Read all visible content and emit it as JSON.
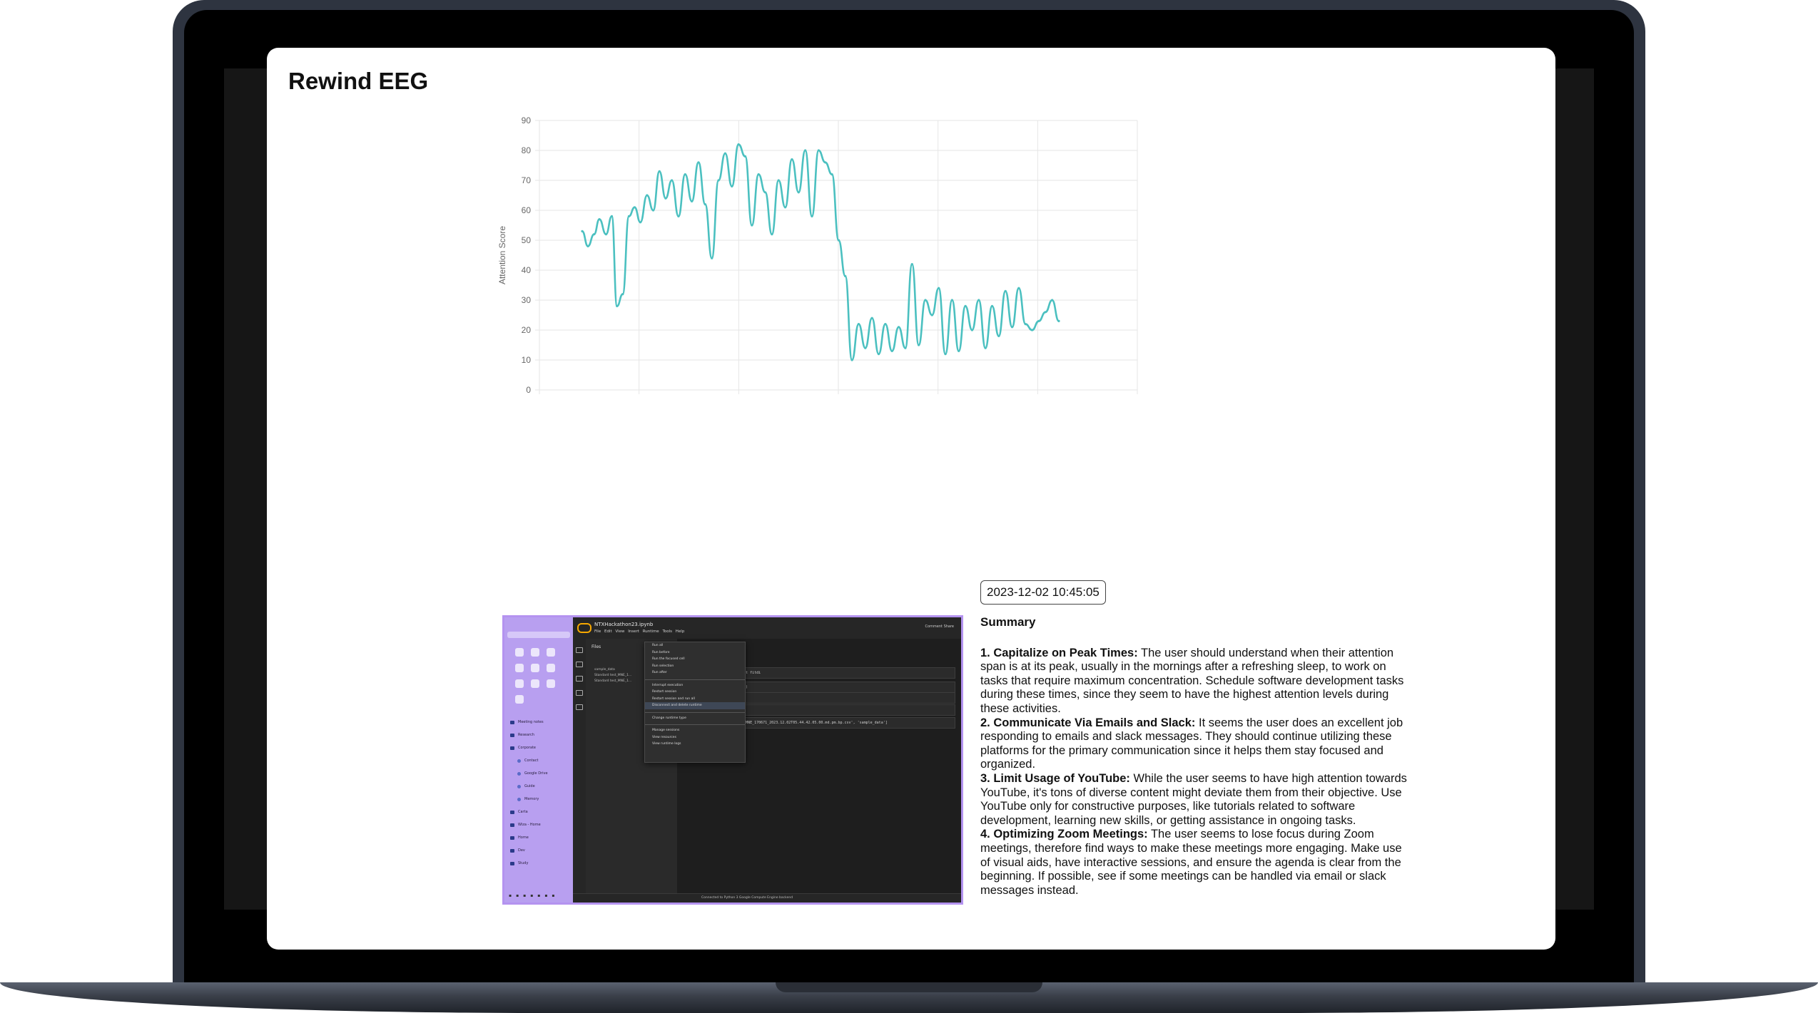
{
  "app": {
    "title": "Rewind EEG"
  },
  "chart_data": {
    "type": "line",
    "title": "",
    "xlabel": "",
    "ylabel": "Attention Score",
    "ylim": [
      0,
      90
    ],
    "yticks": [
      0,
      10,
      20,
      30,
      40,
      50,
      60,
      70,
      80,
      90
    ],
    "grid": true,
    "legend": "none",
    "series": [
      {
        "color": "#4bc0c0",
        "x": [
          0,
          1.2,
          2.5,
          3.6,
          5,
          6.2,
          7.3,
          8.5,
          9.8,
          11,
          12.2,
          13.6,
          14.9,
          16.2,
          17.5,
          18.8,
          20.2,
          21.6,
          23,
          24.4,
          25.8,
          27.2,
          28.6,
          30,
          31.4,
          32.8,
          34.2,
          35.6,
          37,
          38.4,
          39.8,
          41.2,
          42.6,
          44,
          45.4,
          46.8,
          48.2,
          49.6,
          51,
          52.4,
          53.8,
          55.2,
          56.6,
          58,
          59.4,
          60.8,
          62.2,
          63.6,
          65,
          66.4,
          67.8,
          69.2,
          70.6,
          72,
          73.4,
          74.8,
          76.2,
          77.6,
          79,
          80.4,
          81.8,
          83.2,
          84.6,
          86,
          87.4,
          88.8,
          90.2,
          91.6,
          93,
          94.4,
          95.8,
          97.2,
          98.6,
          100
        ],
        "values": [
          53,
          48,
          52,
          57,
          52,
          58,
          28,
          32,
          58,
          61,
          56,
          65,
          60,
          73,
          64,
          70,
          58,
          72,
          63,
          76,
          62,
          44,
          70,
          79,
          68,
          82,
          78,
          55,
          72,
          66,
          52,
          70,
          61,
          77,
          66,
          80,
          58,
          80,
          76,
          72,
          50,
          38,
          10,
          22,
          14,
          24,
          12,
          22,
          13,
          21,
          14,
          42,
          15,
          30,
          25,
          34,
          12,
          30,
          13,
          28,
          20,
          30,
          14,
          28,
          18,
          33,
          21,
          34,
          22,
          20,
          23,
          26,
          30,
          23
        ],
        "values_tail_note": ""
      }
    ]
  },
  "timestamp": "2023-12-02 10:45:05",
  "summary": {
    "heading": "Summary",
    "items": [
      {
        "title": "1. Capitalize on Peak Times:",
        "text": " The user should understand when their attention span is at its peak, usually in the mornings after a refreshing sleep, to work on tasks that require maximum concentration. Schedule software development tasks during these times, since they seem to have the highest attention levels during these activities."
      },
      {
        "title": "2. Communicate Via Emails and Slack:",
        "text": " It seems the user does an excellent job responding to emails and slack messages. They should continue utilizing these platforms for the primary communication since it helps them stay focused and organized."
      },
      {
        "title": "3. Limit Usage of YouTube:",
        "text": " While the user seems to have high attention towards YouTube, it's tons of diverse content might deviate them from their objective. Use YouTube only for constructive purposes, like tutorials related to software development, learning new skills, or getting assistance in ongoing tasks."
      },
      {
        "title": "4. Optimizing Zoom Meetings:",
        "text": " The user seems to lose focus during Zoom meetings, therefore find ways to make these meetings more engaging. Make use of visual aids, have interactive sessions, and ensure the agenda is clear from the beginning. If possible, see if some meetings can be handled via email or slack messages instead."
      }
    ]
  },
  "screenshot": {
    "notebook_name": "NTXHackathon23.ipynb",
    "menu": [
      "File",
      "Edit",
      "View",
      "Insert",
      "Runtime",
      "Tools",
      "Help"
    ],
    "top_right": "Comment   Share",
    "files_title": "Files",
    "files": [
      "sample_data",
      "Standard test_MNE_1...",
      "Standard test_MNE_1..."
    ],
    "context_menu": [
      "Run all",
      "Run before",
      "Run the focused cell",
      "Run selection",
      "Run after",
      "Interrupt execution",
      "Restart session",
      "Restart session and run all",
      "Disconnect and delete runtime",
      "Change runtime type",
      "Manage sessions",
      "View resources",
      "View runtime logs"
    ],
    "sidebar_items": [
      "Meeting notes",
      "Research",
      "Corporate",
      "Contact",
      "Google Drive",
      "Guide",
      "Memory",
      "Carta",
      "Wiza - Home",
      "Home",
      "Dev",
      "Study"
    ],
    "code_lines": [
      "import fitdi",
      "(load)",
      "token",
      "...",
      "test_MNE_170671_2023.12.02T05.44.42.05.00.md.pm.bp.csv', 'sample_data']"
    ],
    "status": "Connected to Python 3 Google Compute Engine backend",
    "disk": "Disk"
  }
}
